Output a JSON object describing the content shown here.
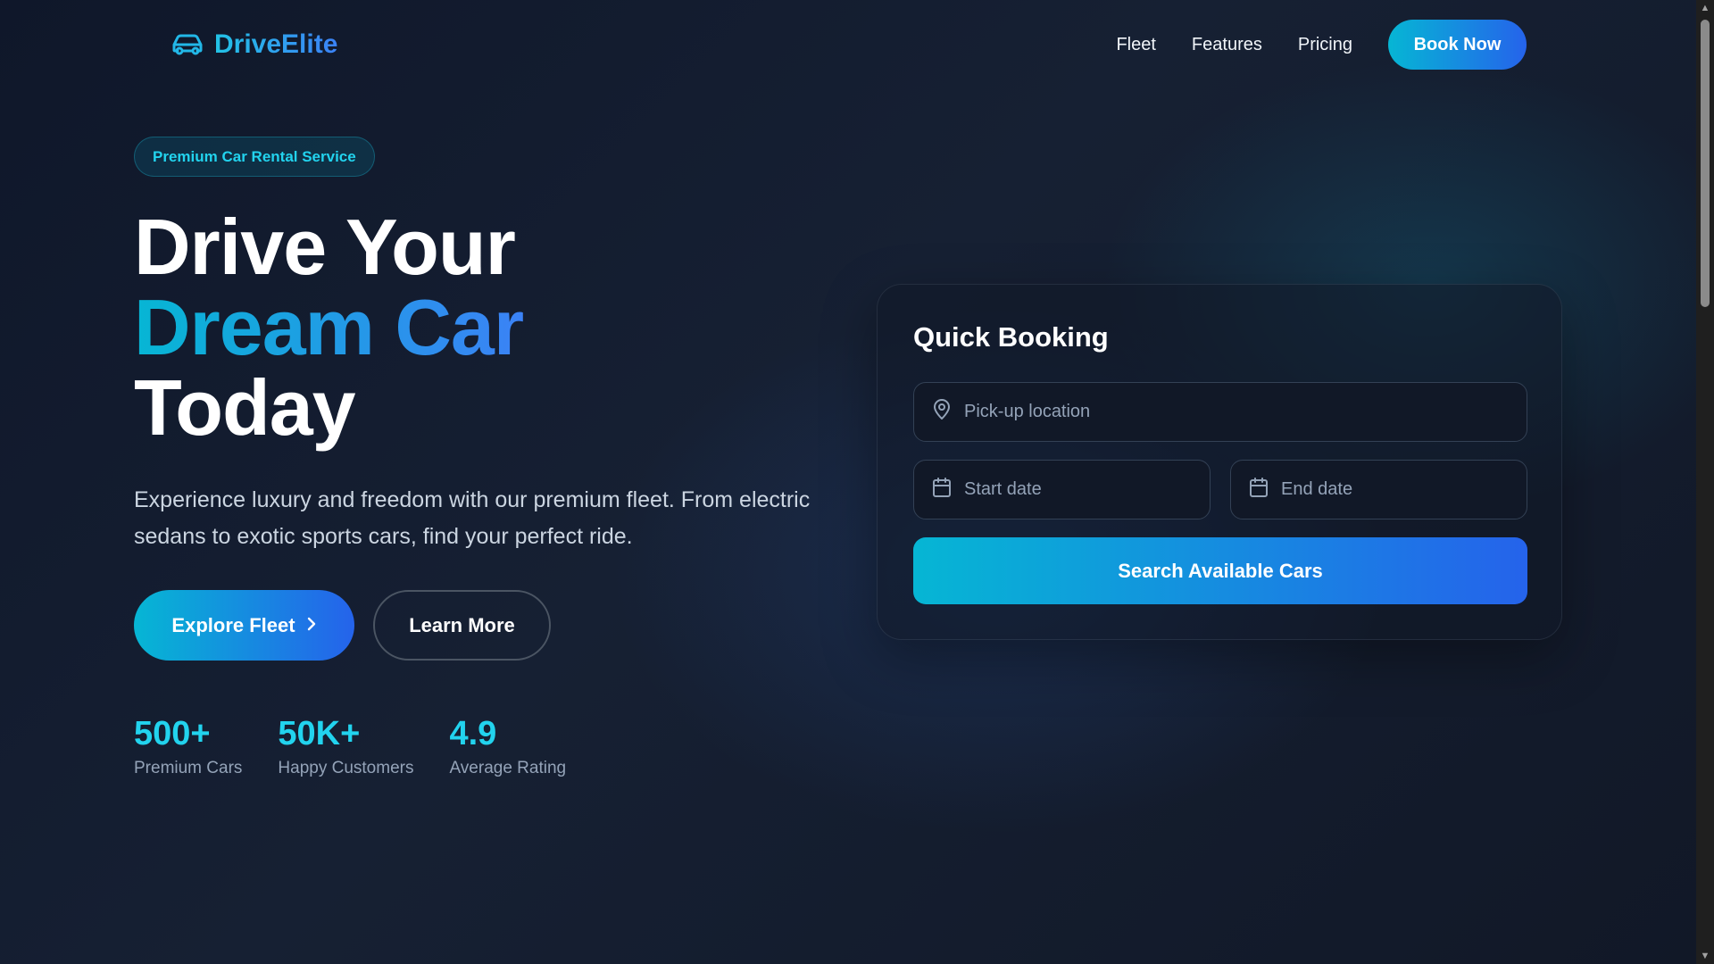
{
  "nav": {
    "logo_text": "DriveElite",
    "logo_icon": "car-icon",
    "links": [
      "Fleet",
      "Features",
      "Pricing"
    ],
    "cta_label": "Book Now"
  },
  "hero": {
    "badge": "Premium Car Rental Service",
    "headline_line1": "Drive Your",
    "headline_accent": "Dream Car",
    "headline_line3": "Today",
    "description": "Experience luxury and freedom with our premium fleet. From electric sedans to exotic sports cars, find your perfect ride.",
    "primary_button": "Explore Fleet",
    "primary_button_icon": "chevron-right-icon",
    "secondary_button": "Learn More"
  },
  "stats": [
    {
      "value": "500+",
      "label": "Premium Cars"
    },
    {
      "value": "50K+",
      "label": "Happy Customers"
    },
    {
      "value": "4.9",
      "label": "Average Rating"
    }
  ],
  "booking": {
    "title": "Quick Booking",
    "pickup_placeholder": "Pick-up location",
    "pickup_icon": "map-pin-icon",
    "start_date_placeholder": "Start date",
    "end_date_placeholder": "End date",
    "date_icon": "calendar-icon",
    "search_button": "Search Available Cars"
  },
  "colors": {
    "background": "#111827",
    "accent_cyan": "#22d3ee",
    "accent_blue": "#2563eb",
    "muted_text": "#94a3b8"
  }
}
